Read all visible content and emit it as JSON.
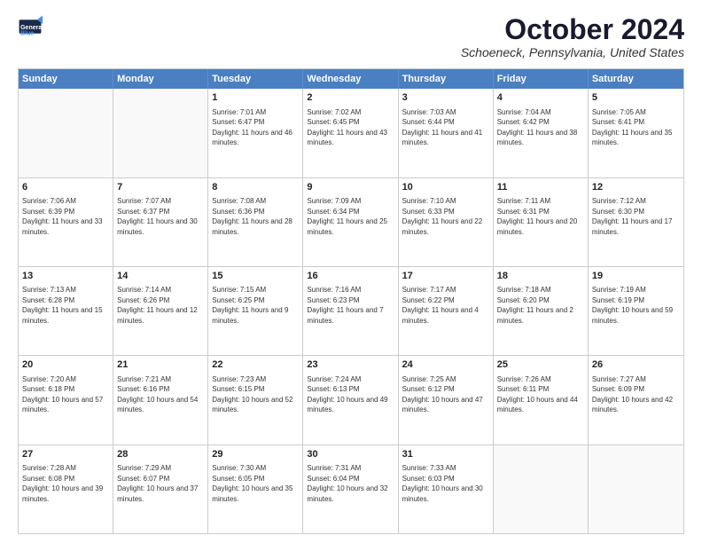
{
  "logo": {
    "line1": "General",
    "line2": "Blue"
  },
  "title": "October 2024",
  "location": "Schoeneck, Pennsylvania, United States",
  "header_days": [
    "Sunday",
    "Monday",
    "Tuesday",
    "Wednesday",
    "Thursday",
    "Friday",
    "Saturday"
  ],
  "weeks": [
    [
      {
        "day": "",
        "text": ""
      },
      {
        "day": "",
        "text": ""
      },
      {
        "day": "1",
        "text": "Sunrise: 7:01 AM\nSunset: 6:47 PM\nDaylight: 11 hours and 46 minutes."
      },
      {
        "day": "2",
        "text": "Sunrise: 7:02 AM\nSunset: 6:45 PM\nDaylight: 11 hours and 43 minutes."
      },
      {
        "day": "3",
        "text": "Sunrise: 7:03 AM\nSunset: 6:44 PM\nDaylight: 11 hours and 41 minutes."
      },
      {
        "day": "4",
        "text": "Sunrise: 7:04 AM\nSunset: 6:42 PM\nDaylight: 11 hours and 38 minutes."
      },
      {
        "day": "5",
        "text": "Sunrise: 7:05 AM\nSunset: 6:41 PM\nDaylight: 11 hours and 35 minutes."
      }
    ],
    [
      {
        "day": "6",
        "text": "Sunrise: 7:06 AM\nSunset: 6:39 PM\nDaylight: 11 hours and 33 minutes."
      },
      {
        "day": "7",
        "text": "Sunrise: 7:07 AM\nSunset: 6:37 PM\nDaylight: 11 hours and 30 minutes."
      },
      {
        "day": "8",
        "text": "Sunrise: 7:08 AM\nSunset: 6:36 PM\nDaylight: 11 hours and 28 minutes."
      },
      {
        "day": "9",
        "text": "Sunrise: 7:09 AM\nSunset: 6:34 PM\nDaylight: 11 hours and 25 minutes."
      },
      {
        "day": "10",
        "text": "Sunrise: 7:10 AM\nSunset: 6:33 PM\nDaylight: 11 hours and 22 minutes."
      },
      {
        "day": "11",
        "text": "Sunrise: 7:11 AM\nSunset: 6:31 PM\nDaylight: 11 hours and 20 minutes."
      },
      {
        "day": "12",
        "text": "Sunrise: 7:12 AM\nSunset: 6:30 PM\nDaylight: 11 hours and 17 minutes."
      }
    ],
    [
      {
        "day": "13",
        "text": "Sunrise: 7:13 AM\nSunset: 6:28 PM\nDaylight: 11 hours and 15 minutes."
      },
      {
        "day": "14",
        "text": "Sunrise: 7:14 AM\nSunset: 6:26 PM\nDaylight: 11 hours and 12 minutes."
      },
      {
        "day": "15",
        "text": "Sunrise: 7:15 AM\nSunset: 6:25 PM\nDaylight: 11 hours and 9 minutes."
      },
      {
        "day": "16",
        "text": "Sunrise: 7:16 AM\nSunset: 6:23 PM\nDaylight: 11 hours and 7 minutes."
      },
      {
        "day": "17",
        "text": "Sunrise: 7:17 AM\nSunset: 6:22 PM\nDaylight: 11 hours and 4 minutes."
      },
      {
        "day": "18",
        "text": "Sunrise: 7:18 AM\nSunset: 6:20 PM\nDaylight: 11 hours and 2 minutes."
      },
      {
        "day": "19",
        "text": "Sunrise: 7:19 AM\nSunset: 6:19 PM\nDaylight: 10 hours and 59 minutes."
      }
    ],
    [
      {
        "day": "20",
        "text": "Sunrise: 7:20 AM\nSunset: 6:18 PM\nDaylight: 10 hours and 57 minutes."
      },
      {
        "day": "21",
        "text": "Sunrise: 7:21 AM\nSunset: 6:16 PM\nDaylight: 10 hours and 54 minutes."
      },
      {
        "day": "22",
        "text": "Sunrise: 7:23 AM\nSunset: 6:15 PM\nDaylight: 10 hours and 52 minutes."
      },
      {
        "day": "23",
        "text": "Sunrise: 7:24 AM\nSunset: 6:13 PM\nDaylight: 10 hours and 49 minutes."
      },
      {
        "day": "24",
        "text": "Sunrise: 7:25 AM\nSunset: 6:12 PM\nDaylight: 10 hours and 47 minutes."
      },
      {
        "day": "25",
        "text": "Sunrise: 7:26 AM\nSunset: 6:11 PM\nDaylight: 10 hours and 44 minutes."
      },
      {
        "day": "26",
        "text": "Sunrise: 7:27 AM\nSunset: 6:09 PM\nDaylight: 10 hours and 42 minutes."
      }
    ],
    [
      {
        "day": "27",
        "text": "Sunrise: 7:28 AM\nSunset: 6:08 PM\nDaylight: 10 hours and 39 minutes."
      },
      {
        "day": "28",
        "text": "Sunrise: 7:29 AM\nSunset: 6:07 PM\nDaylight: 10 hours and 37 minutes."
      },
      {
        "day": "29",
        "text": "Sunrise: 7:30 AM\nSunset: 6:05 PM\nDaylight: 10 hours and 35 minutes."
      },
      {
        "day": "30",
        "text": "Sunrise: 7:31 AM\nSunset: 6:04 PM\nDaylight: 10 hours and 32 minutes."
      },
      {
        "day": "31",
        "text": "Sunrise: 7:33 AM\nSunset: 6:03 PM\nDaylight: 10 hours and 30 minutes."
      },
      {
        "day": "",
        "text": ""
      },
      {
        "day": "",
        "text": ""
      }
    ]
  ]
}
